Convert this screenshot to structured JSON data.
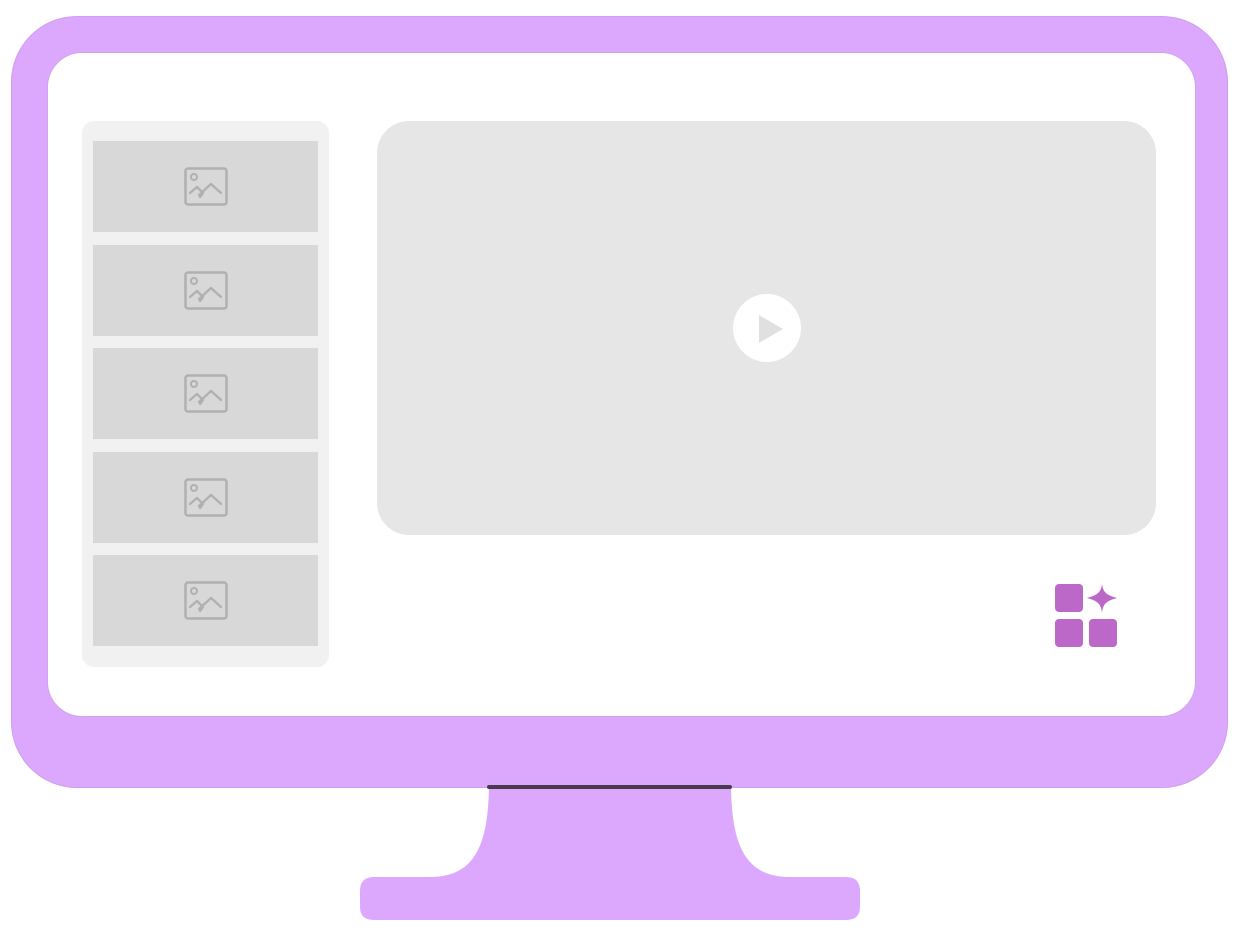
{
  "colors": {
    "frame": "#dca8fd",
    "screen": "#ffffff",
    "sidebar": "#f1f1f1",
    "thumb": "#d8d8d8",
    "thumb_icon": "#b0b0b0",
    "player": "#e6e6e6",
    "play_icon": "#e0e0e0",
    "accent": "#bb68c9"
  },
  "sidebar": {
    "items": [
      {
        "icon": "image-icon"
      },
      {
        "icon": "image-icon"
      },
      {
        "icon": "image-icon"
      },
      {
        "icon": "image-icon"
      },
      {
        "icon": "image-icon"
      }
    ]
  },
  "player": {
    "icon": "play-icon"
  },
  "apps": {
    "icon": "apps-sparkle-icon"
  }
}
